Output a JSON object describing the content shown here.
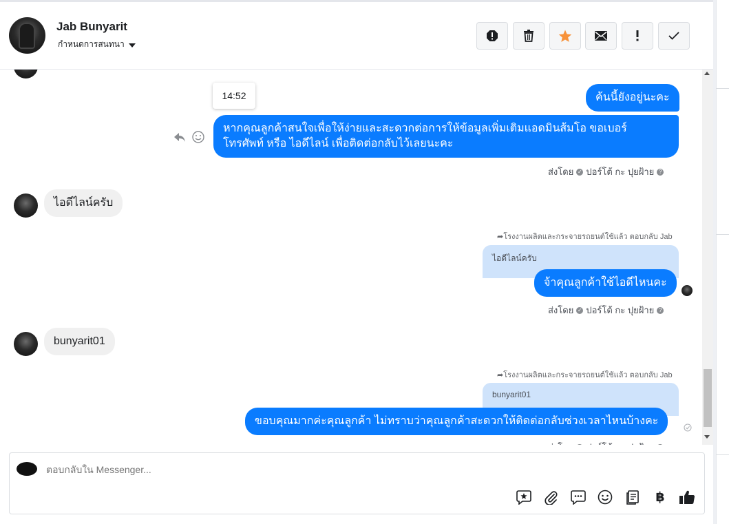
{
  "header": {
    "contact_name": "Jab Bunyarit",
    "conversation_label": "กำหนดการสนทนา",
    "actions": [
      "report-icon",
      "trash-icon",
      "star-icon",
      "mail-icon",
      "exclamation-icon",
      "check-icon"
    ],
    "accent_star": "#f7923a"
  },
  "tooltip": {
    "time": "14:52"
  },
  "messages": {
    "m1": "ค้นนี้ยังอยู่นะคะ",
    "m2_line1": "หากคุณลูกค้าสนใจเพื่อให้ง่ายและสะดวกต่อการให้ข้อมูลเพิ่มเติมแอดมินส้มโอ ขอเบอร์",
    "m2_line2": "โทรศัพท์ หรือ ไอดีไลน์ เพื่อติดต่อกลับไว้เลยนะคะ",
    "m3": "ไอดีไลน์ครับ",
    "m4_reply_meta": "โรงงานผลิตและกระจายรถยนต์ใช้แล้ว ตอบกลับ Jab",
    "m4_quote": "ไอดีไลน์ครับ",
    "m4": "จ้าคุณลูกค้าใช้ไอดีไหนคะ",
    "m5": "bunyarit01",
    "m6_reply_meta": "โรงงานผลิตและกระจายรถยนต์ใช้แล้ว ตอบกลับ Jab",
    "m6_quote": "bunyarit01",
    "m6": "ขอบคุณมากค่ะคุณลูกค้า ไม่ทราบว่าคุณลูกค้าสะดวกให้ติดต่อกลับช่วงเวลาไหนบ้างคะ"
  },
  "sent_by": {
    "prefix": "ส่งโดย",
    "agent": "ปอร์โต้ กะ ปุยฝ้าย",
    "help": "?"
  },
  "composer": {
    "placeholder": "ตอบกลับใน Messenger...",
    "tools": [
      "saved-reply-icon",
      "attachment-icon",
      "quick-reply-icon",
      "emoji-icon",
      "form-icon",
      "baht-icon",
      "like-icon"
    ],
    "baht_symbol": "฿"
  },
  "colors": {
    "bubble_out": "#0a7cff",
    "bubble_in": "#f0f0f0",
    "quote_bg": "#cfe3fb"
  }
}
